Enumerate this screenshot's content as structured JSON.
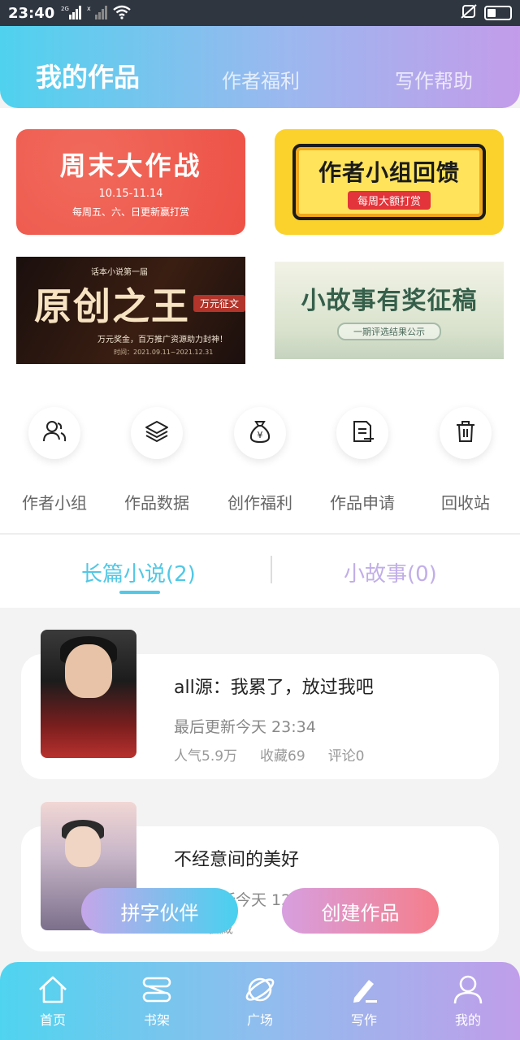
{
  "status_bar": {
    "time": "23:40",
    "signal1": "2G",
    "signal2": "x"
  },
  "header": {
    "tabs": [
      "我的作品",
      "作者福利",
      "写作帮助"
    ]
  },
  "banners": [
    {
      "title": "周末大作战",
      "date": "10.15-11.14",
      "sub": "每周五、六、日更新赢打赏"
    },
    {
      "title": "作者小组回馈",
      "sub": "每周大额打赏"
    },
    {
      "tag": "话本小说第一届",
      "title": "原创之王",
      "pill": "万元征文",
      "sub": "万元奖金，百万推广资源助力封神！",
      "date": "时间：2021.09.11~2021.12.31"
    },
    {
      "title": "小故事有奖征稿",
      "sub": "一期评选结果公示"
    }
  ],
  "quick_actions": [
    {
      "label": "作者小组",
      "icon": "users-icon"
    },
    {
      "label": "作品数据",
      "icon": "layers-icon"
    },
    {
      "label": "创作福利",
      "icon": "money-bag-icon"
    },
    {
      "label": "作品申请",
      "icon": "document-icon"
    },
    {
      "label": "回收站",
      "icon": "trash-icon"
    }
  ],
  "novel_tabs": [
    {
      "label": "长篇小说(2)",
      "active": true
    },
    {
      "label": "小故事(0)",
      "active": false
    }
  ],
  "books": [
    {
      "title": "all源：我累了，放过我吧",
      "update": "最后更新今天 23:34",
      "popularity": "人气5.9万",
      "favorites": "收藏69",
      "comments": "评论0"
    },
    {
      "title": "不经意间的美好",
      "update": "最后更新今天 12",
      "popularity": "9",
      "favorites": "收藏"
    }
  ],
  "floating_buttons": {
    "partner": "拼字伙伴",
    "create": "创建作品"
  },
  "bottom_nav": [
    {
      "label": "首页",
      "icon": "home-icon"
    },
    {
      "label": "书架",
      "icon": "bookshelf-icon"
    },
    {
      "label": "广场",
      "icon": "planet-icon"
    },
    {
      "label": "写作",
      "icon": "pen-icon"
    },
    {
      "label": "我的",
      "icon": "user-icon"
    }
  ],
  "colors": {
    "accent": "#51c8e6",
    "secondary": "#c1aee8",
    "create": "#f57e8b"
  }
}
